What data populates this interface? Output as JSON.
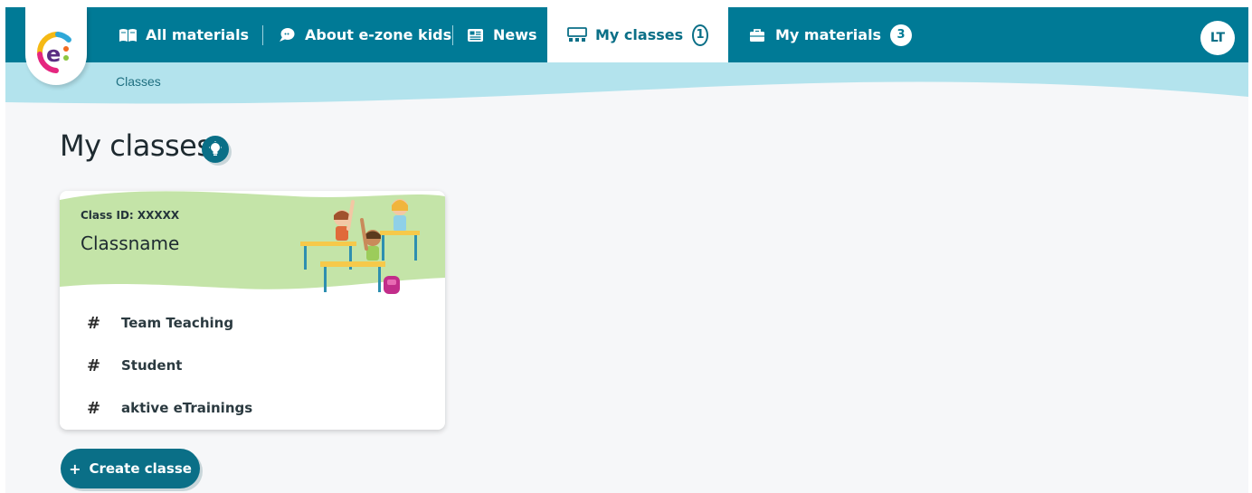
{
  "nav": {
    "all_materials": "All materials",
    "about": "About e-zone kids",
    "news": "News",
    "my_classes": "My classes",
    "my_classes_count": "1",
    "my_materials": "My materials",
    "my_materials_count": "3"
  },
  "user": {
    "initials": "LT"
  },
  "breadcrumb": "Classes",
  "page": {
    "title": "My classes"
  },
  "card": {
    "class_id": "Class ID: XXXXX",
    "class_name": "Classname",
    "stats": [
      {
        "symbol": "#",
        "label": "Team Teaching"
      },
      {
        "symbol": "#",
        "label": "Student"
      },
      {
        "symbol": "#",
        "label": "aktive eTrainings"
      }
    ]
  },
  "actions": {
    "create_plus": "+",
    "create_label": "Create classe"
  },
  "colors": {
    "nav_bg": "#007a96",
    "subbar_bg": "#b3e3ed",
    "card_header_bg": "#c4e4a8",
    "accent": "#0a6f87",
    "page_bg": "#f6f7f9"
  },
  "icons": {
    "all_materials": "book-icon",
    "about": "chat-bubble-icon",
    "news": "newspaper-icon",
    "my_classes": "classroom-icon",
    "my_materials": "briefcase-icon",
    "tip": "lightbulb-icon"
  }
}
